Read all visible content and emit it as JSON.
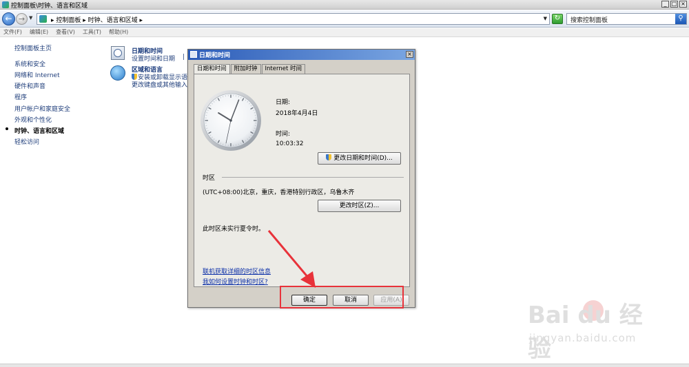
{
  "window": {
    "title": "控制面板\\时钟、语言和区域",
    "buttons": [
      "_",
      "□",
      "×"
    ]
  },
  "address_bar": {
    "path": "▸ 控制面板 ▸ 时钟、语言和区域 ▸",
    "search_placeholder": "搜索控制面板"
  },
  "menu": {
    "items": [
      "文件(F)",
      "编辑(E)",
      "查看(V)",
      "工具(T)",
      "帮助(H)"
    ]
  },
  "sidebar": {
    "items": [
      {
        "label": "控制面板主页"
      },
      {
        "label": "系统和安全"
      },
      {
        "label": "网络和 Internet"
      },
      {
        "label": "硬件和声音"
      },
      {
        "label": "程序"
      },
      {
        "label": "用户帐户和家庭安全"
      },
      {
        "label": "外观和个性化"
      },
      {
        "label": "时钟、语言和区域",
        "current": true
      },
      {
        "label": "轻松访问"
      }
    ]
  },
  "categories": [
    {
      "icon": "clock-icon",
      "title": "日期和时间",
      "links": [
        "设置时间和日期",
        "|"
      ]
    },
    {
      "icon": "globe-icon",
      "title": "区域和语言",
      "links": [
        "安装或卸载显示语",
        "更改键盘或其他输入"
      ]
    }
  ],
  "dialog": {
    "title": "日期和时间",
    "close": "×",
    "tabs": [
      "日期和时间",
      "附加时钟",
      "Internet 时间"
    ],
    "active_tab": 0,
    "clock": {
      "hour": 10,
      "minute": 3,
      "second": 32
    },
    "date_label": "日期:",
    "date_value": "2018年4月4日",
    "time_label": "时间:",
    "time_value": "10:03:32",
    "change_datetime_btn": "更改日期和时间(D)...",
    "timezone_label": "时区",
    "timezone_value": "(UTC+08:00)北京，重庆，香港特别行政区，乌鲁木齐",
    "change_timezone_btn": "更改时区(Z)...",
    "dst_note": "此时区未实行夏令时。",
    "link_online_tz": "联机获取详细的时区信息",
    "link_how_to": "我如何设置时钟和时区?",
    "ok": "确定",
    "cancel": "取消",
    "apply": "应用(A)"
  },
  "watermark": {
    "brand": "Bai du 经验",
    "url": "jingyan.baidu.com"
  },
  "colors": {
    "annotation_red": "#e8323a",
    "dialog_titlebar": "#2c5cb8",
    "link_blue": "#0b2fa8"
  }
}
